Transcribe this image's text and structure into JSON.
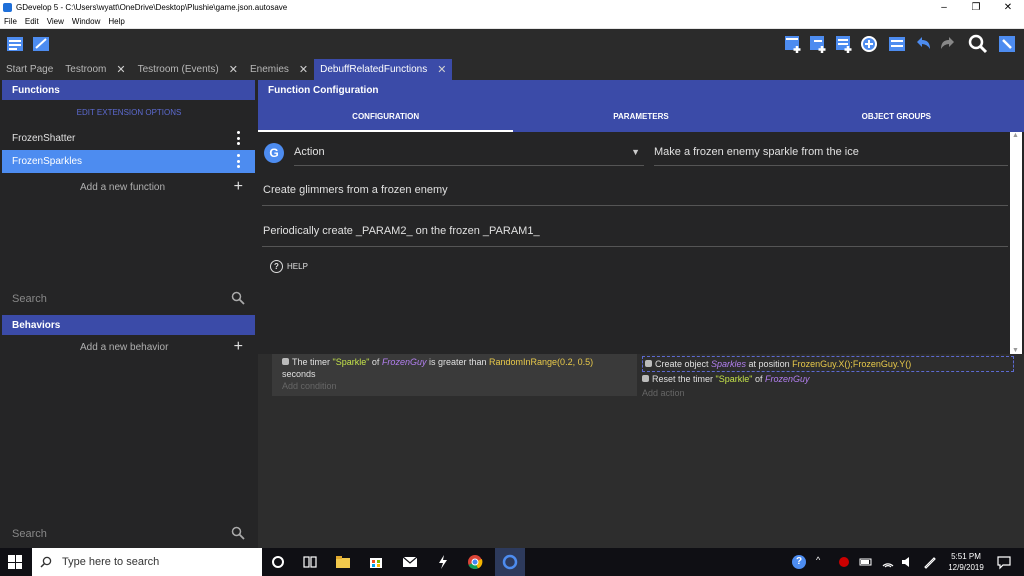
{
  "window": {
    "title": "GDevelop 5 - C:\\Users\\wyatt\\OneDrive\\Desktop\\Plushie\\game.json.autosave",
    "controls": [
      "–",
      "❐",
      "✕"
    ]
  },
  "menu": [
    "File",
    "Edit",
    "View",
    "Window",
    "Help"
  ],
  "tabs": [
    {
      "label": "Start Page",
      "closable": false
    },
    {
      "label": "Testroom",
      "closable": true
    },
    {
      "label": "Testroom (Events)",
      "closable": true
    },
    {
      "label": "Enemies",
      "closable": true
    },
    {
      "label": "DebuffRelatedFunctions",
      "closable": true,
      "active": true
    }
  ],
  "left": {
    "functions_title": "Functions",
    "edit_options": "EDIT EXTENSION OPTIONS",
    "functions": [
      "FrozenShatter",
      "FrozenSparkles"
    ],
    "add_function": "Add a new function",
    "search1": "Search",
    "behaviors_title": "Behaviors",
    "add_behavior": "Add a new behavior",
    "search2": "Search"
  },
  "config": {
    "title": "Function Configuration",
    "tabs": [
      "CONFIGURATION",
      "PARAMETERS",
      "OBJECT GROUPS"
    ],
    "type": "Action",
    "full_name": "Make a frozen enemy sparkle from the ice",
    "description": "Create glimmers from a frozen enemy",
    "sentence": "Periodically create _PARAM2_ on the frozen _PARAM1_",
    "help": "HELP"
  },
  "events": {
    "cond_prefix": "The timer ",
    "cond_timer": "\"Sparkle\"",
    "cond_of": " of ",
    "cond_obj": "FrozenGuy",
    "cond_mid": " is greater than ",
    "cond_expr": "RandomInRange(0.2, 0.5)",
    "cond_suffix": "seconds",
    "add_condition": "Add condition",
    "act1_prefix": "Create object ",
    "act1_obj": "Sparkles",
    "act1_mid": " at position ",
    "act1_expr": "FrozenGuy.X();FrozenGuy.Y()",
    "act2_prefix": "Reset the timer ",
    "act2_timer": "\"Sparkle\"",
    "act2_of": " of ",
    "act2_obj": "FrozenGuy",
    "add_action": "Add action"
  },
  "taskbar": {
    "search_placeholder": "Type here to search",
    "time": "5:51 PM",
    "date": "12/9/2019"
  },
  "colors": {
    "accent": "#3b4ba8",
    "selected": "#4d8cf0"
  }
}
